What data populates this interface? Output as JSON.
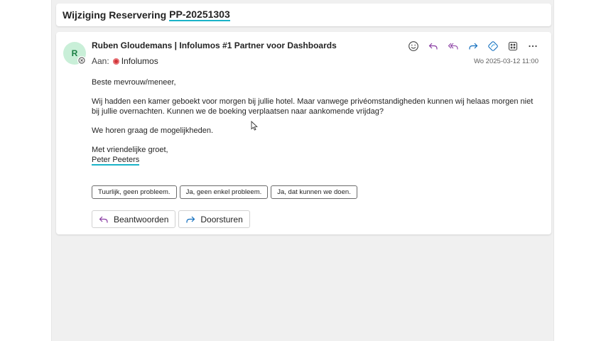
{
  "subject": {
    "prefix": "Wijziging Reservering",
    "reference": "PP-20251303"
  },
  "message": {
    "avatar_initial": "R",
    "sender": "Ruben Gloudemans | Infolumos #1 Partner voor Dashboards",
    "to_label": "Aan:",
    "recipient": "Infolumos",
    "timestamp": "Wo 2025-03-12 11:00",
    "toolbar": [
      "emoji-icon",
      "reply-icon",
      "reply-all-icon",
      "forward-icon",
      "loop-icon",
      "apps-icon",
      "more-icon"
    ],
    "body": {
      "greeting": "Beste mevrouw/meneer,",
      "paragraph": "Wij hadden een kamer geboekt voor morgen bij jullie hotel. Maar vanwege privéomstandigheden kunnen wij helaas morgen niet bij jullie overnachten. Kunnen we de boeking verplaatsen naar aankomende vrijdag?",
      "closing_line": "We horen graag de mogelijkheden.",
      "sign_off": "Met vriendelijke groet,",
      "signature": "Peter Peeters"
    },
    "suggested_replies": [
      "Tuurlijk, geen probleem.",
      "Ja, geen enkel probleem.",
      "Ja, dat kunnen we doen."
    ],
    "actions": {
      "reply": "Beantwoorden",
      "forward": "Doorsturen"
    }
  },
  "colors": {
    "accent": "#1bb3c8",
    "reply_purple": "#8a3ea3",
    "forward_blue": "#0f6cbd",
    "avatar_bg": "#c9efd8"
  }
}
